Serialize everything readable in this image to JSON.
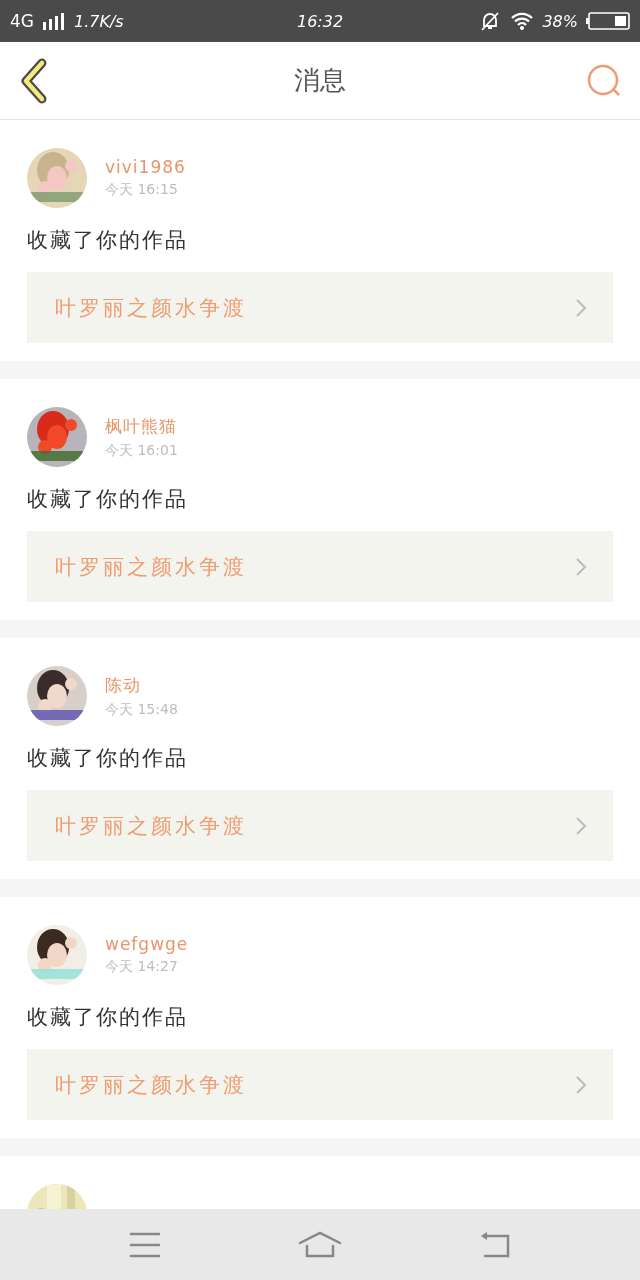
{
  "status_bar": {
    "network": "4G",
    "speed": "1.7K/s",
    "time": "16:32",
    "battery": "38%"
  },
  "header": {
    "title": "消息"
  },
  "messages": [
    {
      "user": "vivi1986",
      "time": "今天 16:15",
      "action": "收藏了你的作品",
      "work": "叶罗丽之颜水争渡"
    },
    {
      "user": "枫叶熊猫",
      "time": "今天 16:01",
      "action": "收藏了你的作品",
      "work": "叶罗丽之颜水争渡"
    },
    {
      "user": "陈动",
      "time": "今天 15:48",
      "action": "收藏了你的作品",
      "work": "叶罗丽之颜水争渡"
    },
    {
      "user": "wefgwge",
      "time": "今天 14:27",
      "action": "收藏了你的作品",
      "work": "叶罗丽之颜水争渡"
    }
  ]
}
